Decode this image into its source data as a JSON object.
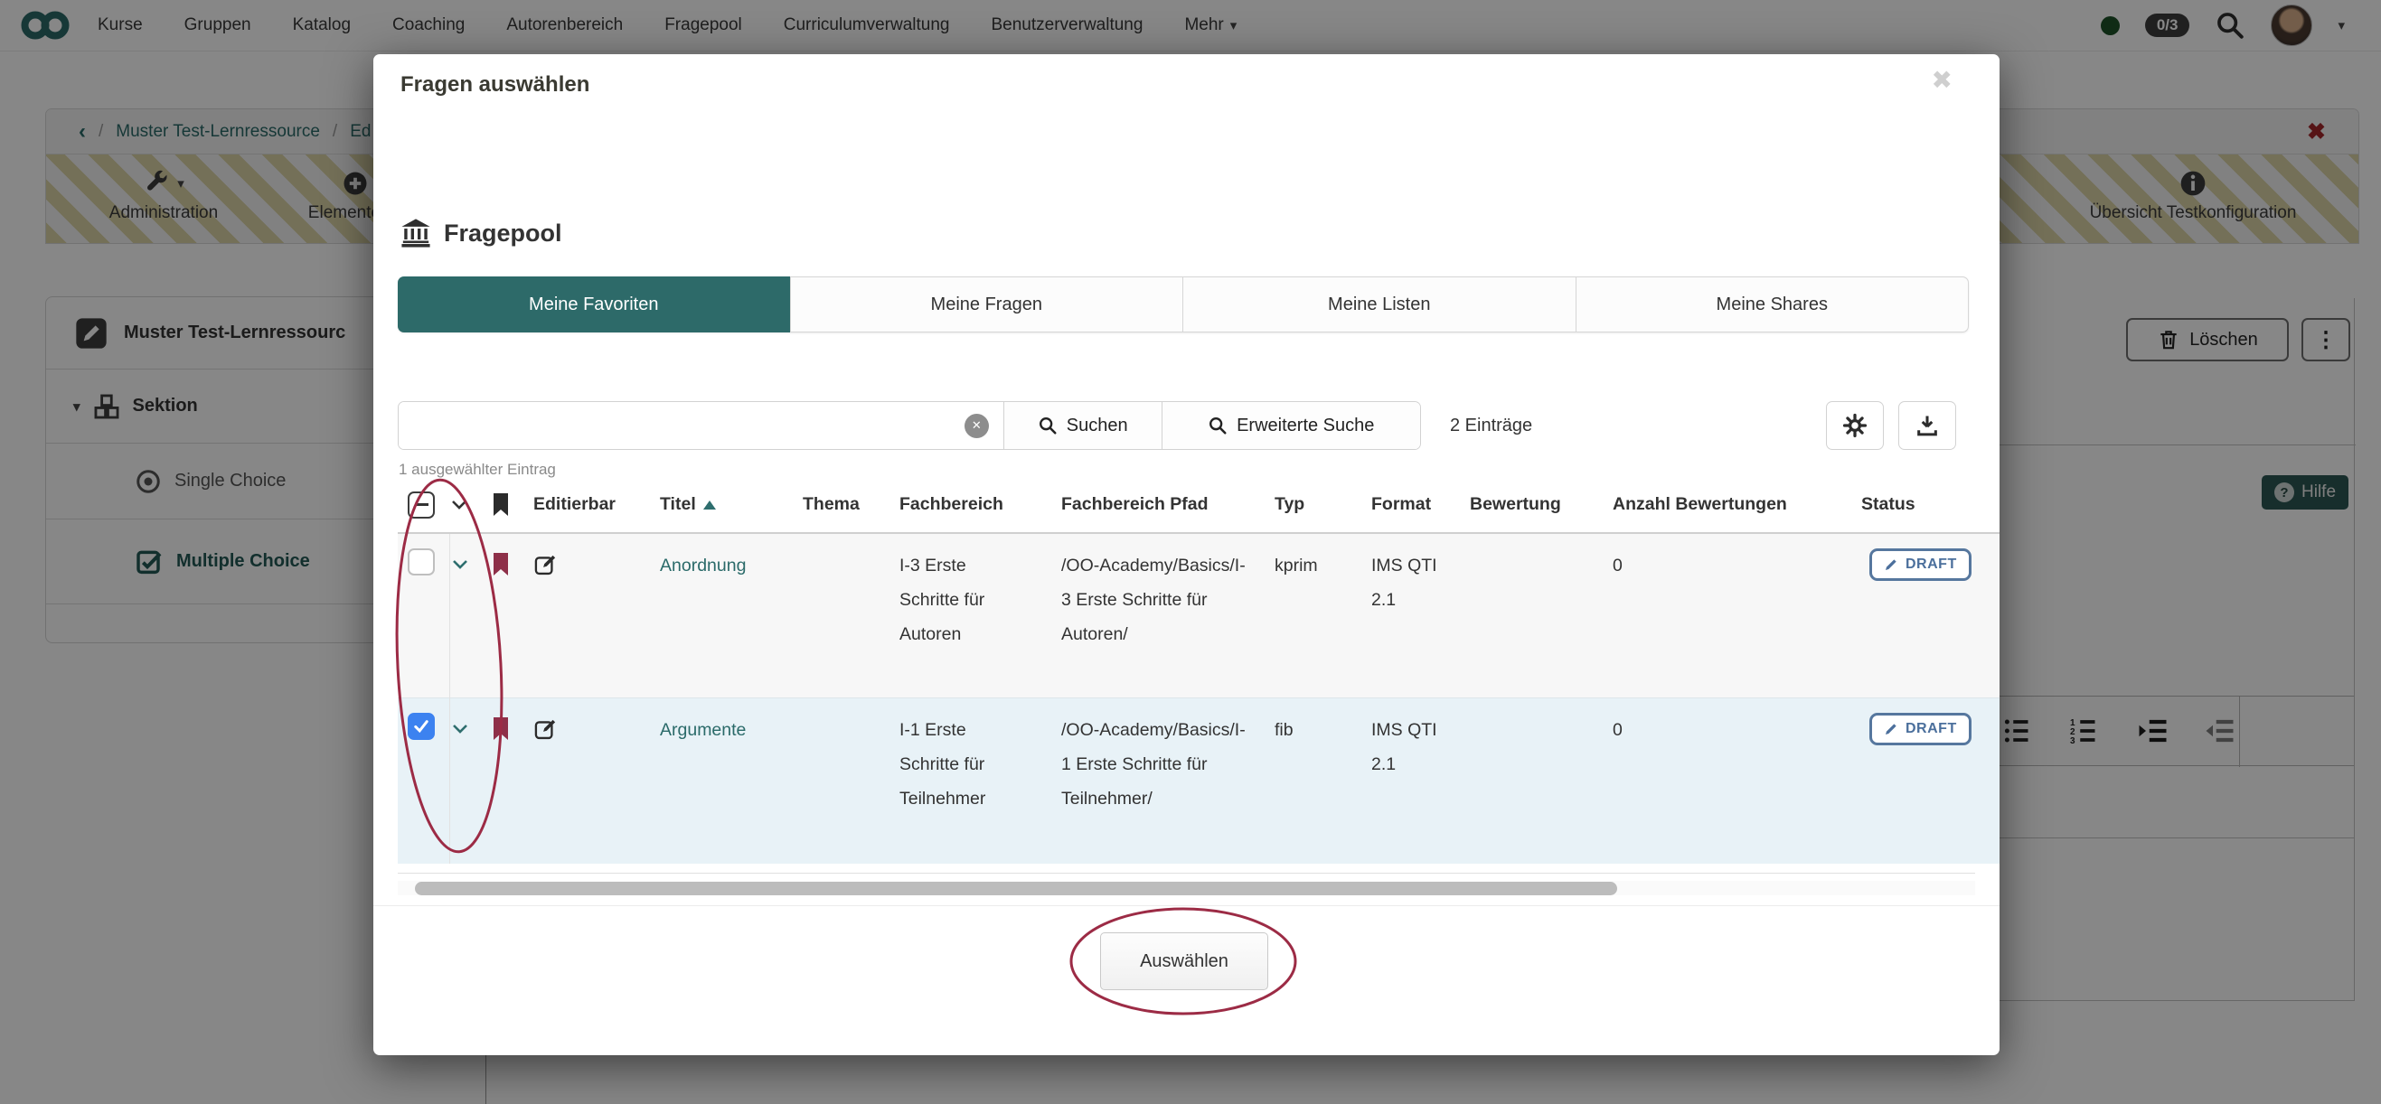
{
  "colors": {
    "brand_teal": "#2d6a69",
    "link_teal": "#2a6a69",
    "bookmark_maroon": "#8e3049",
    "annotation_red": "#9c2b45",
    "checked_blue": "#3c82f0",
    "draft_badge_blue": "#56779e",
    "danger_red": "#a3272b",
    "selected_row_bg": "#e8f2f7"
  },
  "icons": {
    "caret_down": "▾",
    "close_x": "✖",
    "kebab": "⋮",
    "back_chevron": "‹",
    "slash": "/",
    "question": "?",
    "clear_x": "✕"
  },
  "navbar": {
    "items": [
      "Kurse",
      "Gruppen",
      "Katalog",
      "Coaching",
      "Autorenbereich",
      "Fragepool",
      "Curriculumverwaltung",
      "Benutzerverwaltung"
    ],
    "more_label": "Mehr",
    "status_badge": "0/3"
  },
  "background": {
    "breadcrumb": {
      "item1": "Muster Test-Lernressource",
      "item2": "Ed"
    },
    "toolbar": {
      "administration": "Administration",
      "add_elements": "Elemente hinz",
      "overview": "Übersicht Testkonfiguration"
    },
    "tree": {
      "title": "Muster Test-Lernressourc",
      "items": [
        {
          "label": "Sektion"
        },
        {
          "label": "Single Choice"
        },
        {
          "label": "Multiple Choice"
        }
      ]
    },
    "delete_label": "Löschen",
    "help_label": "Hilfe"
  },
  "modal": {
    "title": "Fragen auswählen",
    "pool_heading": "Fragepool",
    "tabs": [
      {
        "label": "Meine Favoriten",
        "active": true
      },
      {
        "label": "Meine Fragen",
        "active": false
      },
      {
        "label": "Meine Listen",
        "active": false
      },
      {
        "label": "Meine Shares",
        "active": false
      }
    ],
    "search": {
      "value": "",
      "suchen_label": "Suchen",
      "erweiterte_label": "Erweiterte Suche",
      "entries_count": "2 Einträge"
    },
    "selection_info": "1 ausgewählter Eintrag",
    "table": {
      "columns": {
        "editierbar": "Editierbar",
        "titel": "Titel",
        "thema": "Thema",
        "fachbereich": "Fachbereich",
        "fachbereich_pfad": "Fachbereich Pfad",
        "typ": "Typ",
        "format": "Format",
        "bewertung": "Bewertung",
        "anzahl_bewertungen": "Anzahl Bewertungen",
        "status": "Status"
      },
      "rows": [
        {
          "checked": false,
          "titel": "Anordnung",
          "thema": "",
          "fachbereich": "I-3 Erste Schritte für Autoren",
          "fachbereich_pfad": "/OO-Academy/Basics/I-3 Erste Schritte für Autoren/",
          "typ": "kprim",
          "format": "IMS QTI 2.1",
          "bewertung": "",
          "anzahl_bewertungen": "0",
          "status": "DRAFT"
        },
        {
          "checked": true,
          "titel": "Argumente",
          "thema": "",
          "fachbereich": "I-1 Erste Schritte für Teilnehmer",
          "fachbereich_pfad": "/OO-Academy/Basics/I-1 Erste Schritte für Teilnehmer/",
          "typ": "fib",
          "format": "IMS QTI 2.1",
          "bewertung": "",
          "anzahl_bewertungen": "0",
          "status": "DRAFT"
        }
      ]
    },
    "select_button": "Auswählen"
  }
}
